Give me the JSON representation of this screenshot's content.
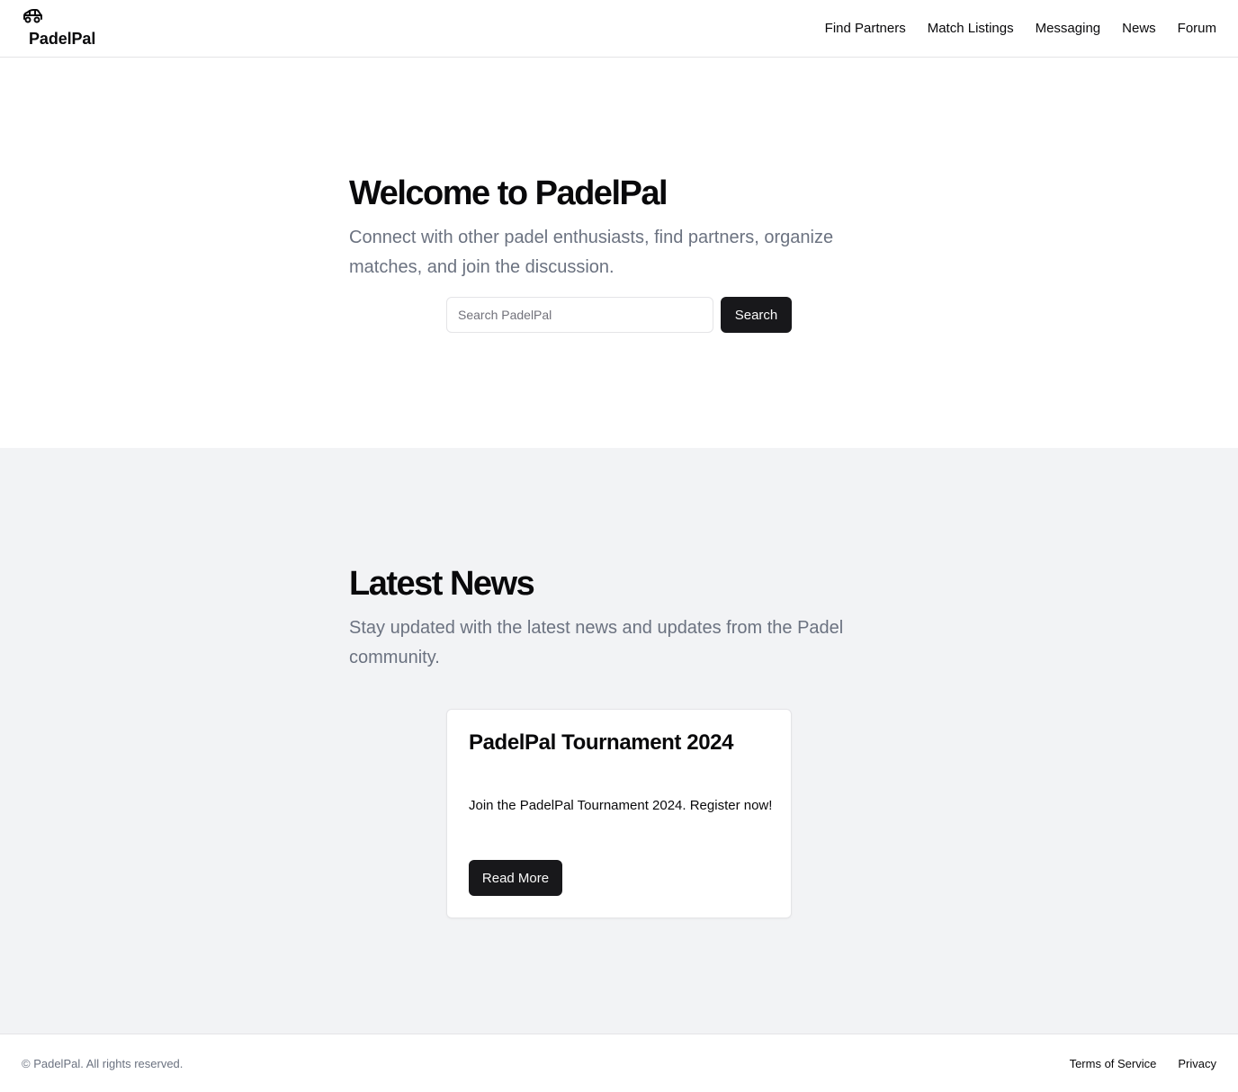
{
  "header": {
    "logo_icon": "car-icon",
    "brand": "PadelPal",
    "nav": [
      "Find Partners",
      "Match Listings",
      "Messaging",
      "News",
      "Forum"
    ]
  },
  "hero": {
    "title": "Welcome to PadelPal",
    "subtitle": "Connect with other padel enthusiasts, find partners, organize matches, and join the discussion.",
    "search": {
      "placeholder": "Search PadelPal",
      "value": "",
      "button_label": "Search"
    }
  },
  "news": {
    "title": "Latest News",
    "subtitle": "Stay updated with the latest news and updates from the Padel community.",
    "cards": [
      {
        "title": "PadelPal Tournament 2024",
        "text": "Join the PadelPal Tournament 2024. Register now!",
        "button_label": "Read More"
      }
    ]
  },
  "footer": {
    "copyright": "© PadelPal. All rights reserved.",
    "links": [
      "Terms of Service",
      "Privacy"
    ]
  },
  "colors": {
    "primary": "#18181b",
    "muted_text": "#6b7280",
    "section_bg": "#f2f3f5",
    "border": "#e4e4e7"
  }
}
